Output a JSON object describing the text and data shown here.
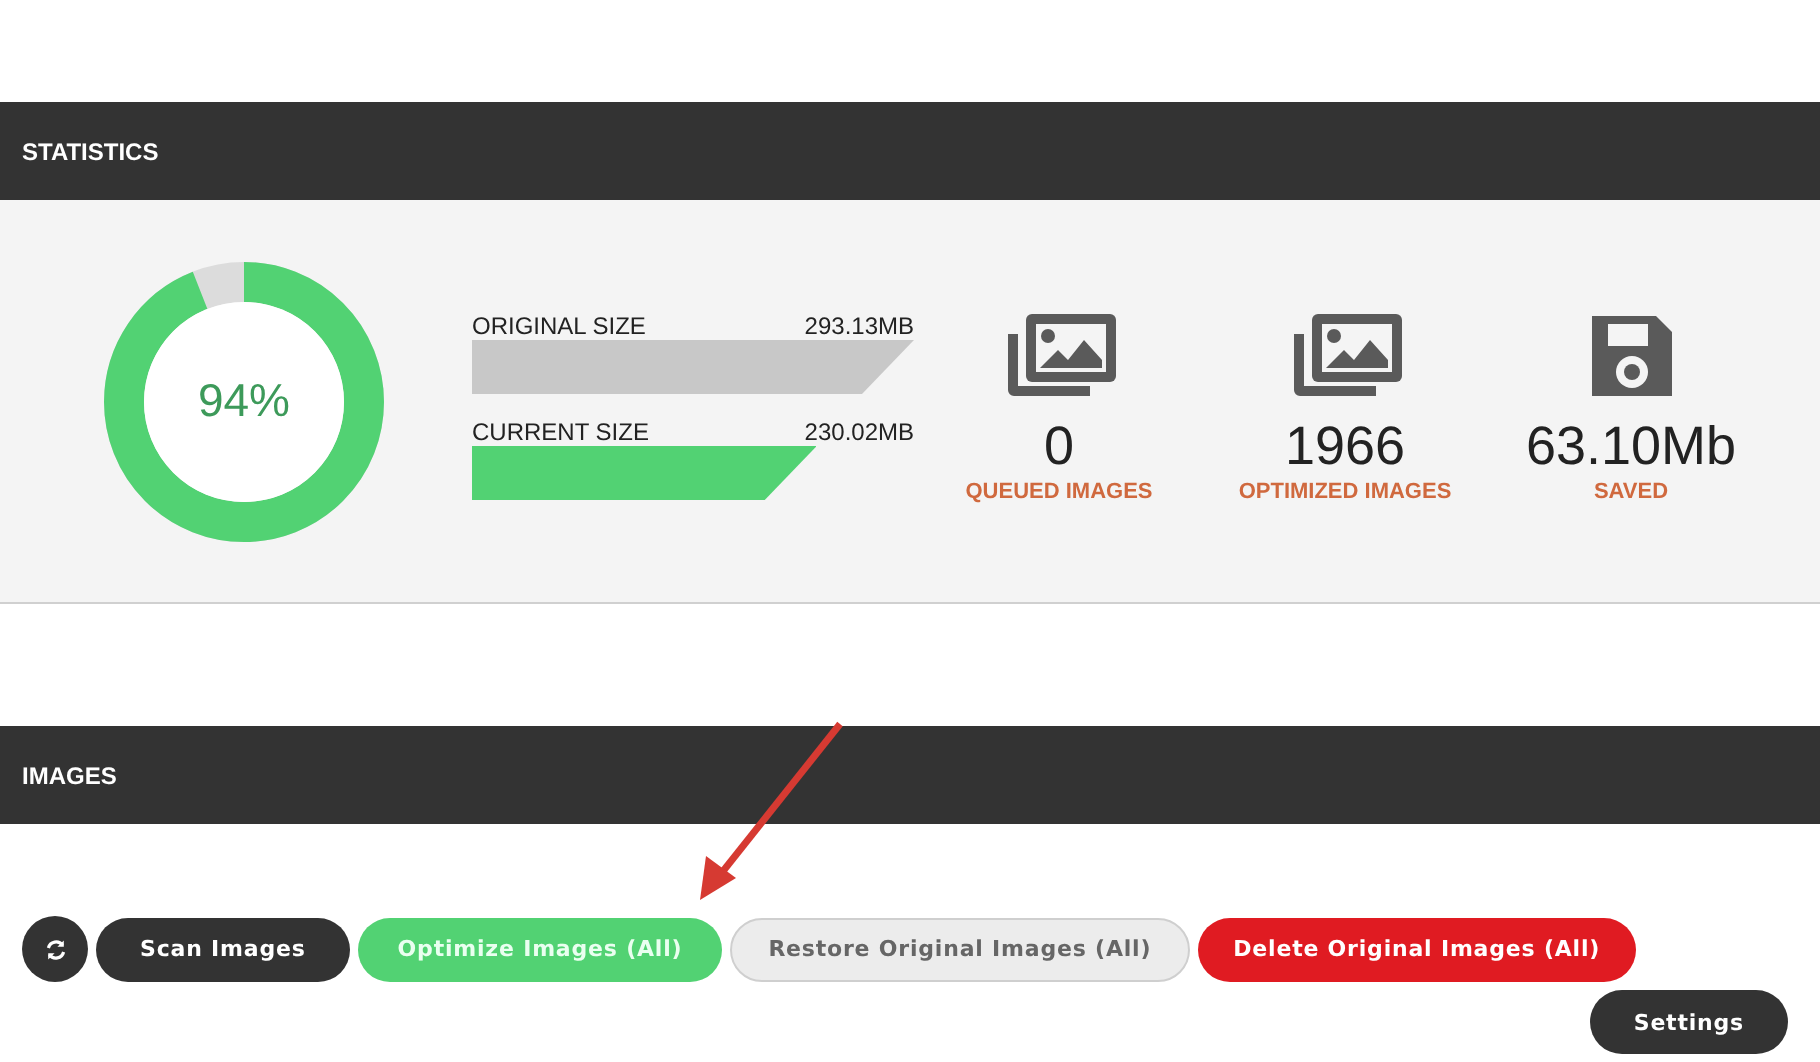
{
  "statistics": {
    "title": "STATISTICS",
    "progress": {
      "level": 0.94,
      "label": "94%"
    },
    "sizes": [
      {
        "label": "ORIGINAL SIZE",
        "value": "293.13MB",
        "kind": "original"
      },
      {
        "label": "CURRENT SIZE",
        "value": "230.02MB",
        "kind": "current"
      }
    ],
    "counters": [
      {
        "kind": "images",
        "value": "0",
        "label": "QUEUED IMAGES"
      },
      {
        "kind": "images",
        "value": "1966",
        "label": "OPTIMIZED IMAGES"
      },
      {
        "kind": "save",
        "value": "63.10Mb",
        "label": "SAVED"
      }
    ]
  },
  "images": {
    "title": "IMAGES",
    "buttons": [
      {
        "kind": "refresh"
      },
      {
        "kind": "dark",
        "label": "Scan Images"
      },
      {
        "kind": "green",
        "label": "Optimize Images (All)"
      },
      {
        "kind": "light",
        "label": "Restore Original Images (All)"
      },
      {
        "kind": "red",
        "label": "Delete Original Images (All)"
      }
    ],
    "settings": {
      "label": "Settings"
    }
  }
}
